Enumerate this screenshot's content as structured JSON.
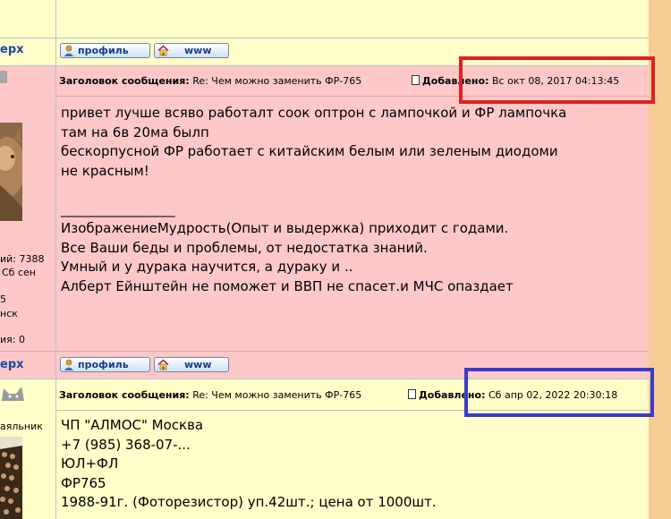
{
  "nav": {
    "top_label": "ерх"
  },
  "buttons": {
    "profile": "профиль",
    "www": "www"
  },
  "post1": {
    "subject_label": "Заголовок сообщения:",
    "subject": "Re: Чем можно заменить ФР-765",
    "added_label": "Добавлено:",
    "added": "Вс окт 08, 2017 04:13:45",
    "body_lines": [
      "привет лучше всяво работалт соок оптрон с лампочкой и ФР лампочка",
      "там на 6в 20ма былп",
      "бескорпусной ФР работает с китайским белым или зеленым диодоми",
      "не красным!",
      "",
      "_________________",
      "ИзображениеМудрость(Опыт и выдержка) приходит с годами.",
      "Все Ваши беды и проблемы, от недостатка знаний.",
      "Умный и у дурака научится, а дураку и ..",
      "Алберт Ейнштейн не поможет и ВВП не спасет.и МЧС опаздает"
    ]
  },
  "author1": {
    "posts_line": "ий: 7388",
    "date_line": "Сб сен",
    "line3": "5",
    "line4": "нск",
    "line5": "ия: 0"
  },
  "post2": {
    "subject_label": "Заголовок сообщения:",
    "subject": "Re: Чем можно заменить ФР-765",
    "added_label": "Добавлено:",
    "added": "Сб апр 02, 2022 20:30:18",
    "body_lines": [
      "ЧП \"АЛМОС\" Москва",
      "+7 (985) 368-07-...",
      "ЮЛ+ФЛ",
      "ФР765",
      "1988-91г. (Фоторезистор) уп.42шт.; цена от 1000шт."
    ]
  },
  "author2": {
    "rank": "аяльник"
  }
}
